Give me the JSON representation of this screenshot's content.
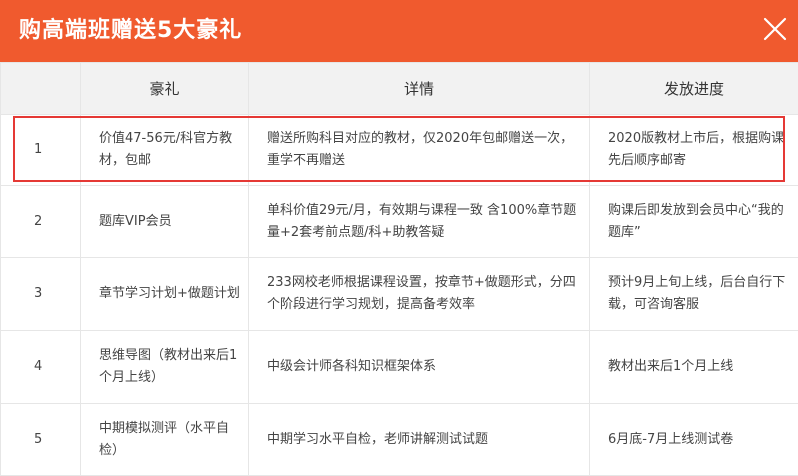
{
  "header": {
    "title": "购高端班赠送5大豪礼",
    "close_icon": "close-icon"
  },
  "table": {
    "columns": [
      "",
      "豪礼",
      "详情",
      "发放进度"
    ],
    "rows": [
      {
        "num": "1",
        "gift": "价值47-56元/科官方教材，包邮",
        "detail": "赠送所购科目对应的教材，仅2020年包邮赠送一次，重学不再赠送",
        "progress": "2020版教材上市后，根据购课先后顺序邮寄"
      },
      {
        "num": "2",
        "gift": "题库VIP会员",
        "detail": "单科价值29元/月，有效期与课程一致 含100%章节题量+2套考前点题/科+助教答疑",
        "progress": "购课后即发放到会员中心“我的题库”"
      },
      {
        "num": "3",
        "gift": "章节学习计划+做题计划",
        "detail": "233网校老师根据课程设置，按章节+做题形式，分四个阶段进行学习规划，提高备考效率",
        "progress": "预计9月上旬上线，后台自行下载，可咨询客服"
      },
      {
        "num": "4",
        "gift": "思维导图（教材出来后1个月上线）",
        "detail": "中级会计师各科知识框架体系",
        "progress": "教材出来后1个月上线"
      },
      {
        "num": "5",
        "gift": "中期模拟测评（水平自检）",
        "detail": "中期学习水平自检，老师讲解测试试题",
        "progress": "6月底-7月上线测试卷"
      }
    ]
  },
  "highlight_color": "#e53935",
  "accent_color": "#f05a2e"
}
